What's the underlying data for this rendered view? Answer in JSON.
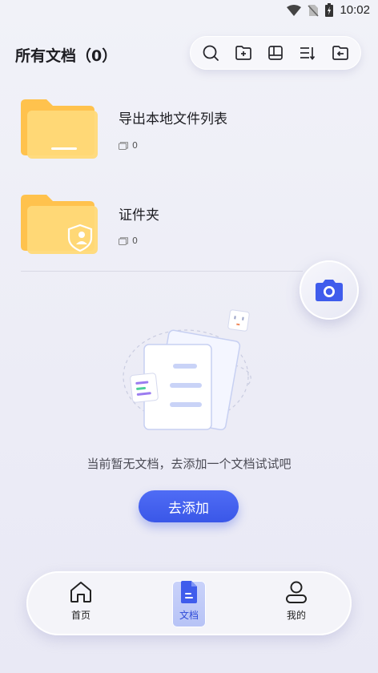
{
  "status_bar": {
    "time": "10:02"
  },
  "header": {
    "title": "所有文档（0）",
    "toolbar": [
      {
        "icon": "search-icon"
      },
      {
        "icon": "new-folder-icon"
      },
      {
        "icon": "layout-icon"
      },
      {
        "icon": "sort-icon"
      },
      {
        "icon": "import-icon"
      }
    ]
  },
  "folders": [
    {
      "name": "导出本地文件列表",
      "count": "0",
      "icon": "folder-icon"
    },
    {
      "name": "证件夹",
      "count": "0",
      "icon": "id-folder-icon"
    }
  ],
  "empty_state": {
    "message": "当前暂无文档，去添加一个文档试试吧",
    "button_label": "去添加"
  },
  "bottom_nav": {
    "items": [
      {
        "label": "首页",
        "icon": "home-icon",
        "active": false
      },
      {
        "label": "文档",
        "icon": "document-icon",
        "active": true
      },
      {
        "label": "我的",
        "icon": "user-icon",
        "active": false
      }
    ]
  },
  "colors": {
    "accent": "#3f5cec",
    "folder": "#ffd36b",
    "background": "#eeeff7"
  }
}
